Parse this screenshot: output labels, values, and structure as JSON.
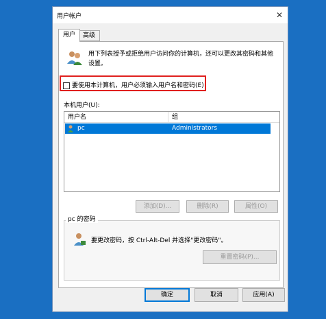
{
  "window": {
    "title": "用户帐户"
  },
  "tabs": [
    {
      "label": "用户",
      "active": true
    },
    {
      "label": "高级",
      "active": false
    }
  ],
  "description": "用下列表授予或拒绝用户访问你的计算机，还可以更改其密码和其他设置。",
  "require_login": {
    "label": "要使用本计算机，用户必须输入用户名和密码(E)",
    "checked": false
  },
  "local_users": {
    "label": "本机用户(U):",
    "columns": [
      "用户名",
      "组"
    ],
    "rows": [
      {
        "user": "pc",
        "group": "Administrators",
        "selected": true
      }
    ]
  },
  "user_buttons": {
    "add": "添加(D)...",
    "remove": "删除(R)",
    "properties": "属性(O)"
  },
  "password_group": {
    "title": "pc 的密码",
    "text": "要更改密码，按 Ctrl-Alt-Del 并选择\"更改密码\"。",
    "reset_button": "重置密码(P)..."
  },
  "dialog_buttons": {
    "ok": "确定",
    "cancel": "取消",
    "apply": "应用(A)"
  },
  "colors": {
    "desktop": "#1a6fc2",
    "selection": "#0078d7",
    "highlight_box": "#e0201e"
  }
}
